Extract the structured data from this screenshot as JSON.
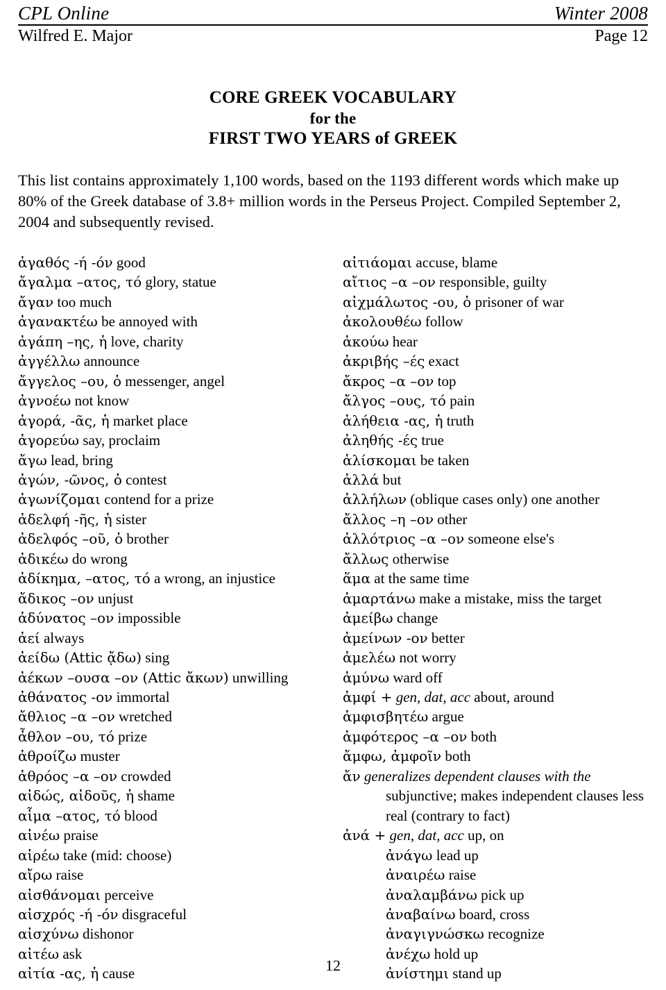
{
  "runhead": {
    "journal": "CPL Online",
    "issue": "Winter 2008",
    "author": "Wilfred E. Major",
    "page_label": "Page 12"
  },
  "title": {
    "line1": "CORE GREEK VOCABULARY",
    "line2": "for the",
    "line3": "FIRST TWO YEARS of GREEK"
  },
  "intro": "This list contains approximately 1,100 words, based on the 1193 different words which make up 80% of the Greek database of 3.8+ million words in the Perseus Project. Compiled September 2, 2004 and subsequently revised.",
  "footer": {
    "page_number": "12"
  },
  "vocabulary": {
    "left_column": [
      {
        "greek": "ἀγαθός -ή -όν",
        "english": "good"
      },
      {
        "greek": "ἄγαλμα –ατος, τό",
        "english": "glory, statue"
      },
      {
        "greek": "ἄγαν",
        "english": "too much"
      },
      {
        "greek": "ἀγανακτέω",
        "english": "be annoyed with"
      },
      {
        "greek": "ἀγάπη –ης, ἡ",
        "english": "love, charity"
      },
      {
        "greek": "ἀγγέλλω",
        "english": "announce"
      },
      {
        "greek": "ἄγγελος –ου, ὁ",
        "english": "messenger, angel"
      },
      {
        "greek": "ἀγνοέω",
        "english": "not know"
      },
      {
        "greek": "ἀγορά, -ᾶς, ἡ",
        "english": "market place"
      },
      {
        "greek": "ἀγορεύω",
        "english": "say, proclaim"
      },
      {
        "greek": "ἄγω",
        "english": "lead, bring"
      },
      {
        "greek": "ἀγών, -ῶνος, ὁ",
        "english": "contest"
      },
      {
        "greek": "ἀγωνίζομαι",
        "english": "contend for a prize"
      },
      {
        "greek": "ἀδελφή -ῆς, ἡ",
        "english": "sister"
      },
      {
        "greek": "ἀδελφός –οῦ, ὁ",
        "english": "brother"
      },
      {
        "greek": "ἀδικέω",
        "english": "do wrong"
      },
      {
        "greek": "ἀδίκημα, –ατος, τό",
        "english": "a wrong, an injustice"
      },
      {
        "greek": "ἄδικος –ον",
        "english": "unjust"
      },
      {
        "greek": "ἀδύνατος –ον",
        "english": "impossible"
      },
      {
        "greek": "ἀεί",
        "english": "always"
      },
      {
        "greek": "ἀείδω (Attic ᾄδω)",
        "english": "sing"
      },
      {
        "greek": "ἀέκων –ουσα –ον (Attic ἄκων)",
        "english": "unwilling"
      },
      {
        "greek": "ἀθάνατος -ον",
        "english": "immortal"
      },
      {
        "greek": "ἄθλιος –α –ον",
        "english": "wretched"
      },
      {
        "greek": "ἆθλον –ου, τό",
        "english": "prize"
      },
      {
        "greek": "ἀθροίζω",
        "english": "muster"
      },
      {
        "greek": "ἀθρόος –α –ον",
        "english": "crowded"
      },
      {
        "greek": "αἰδώς, αἰδοῦς, ἡ",
        "english": "shame"
      },
      {
        "greek": "αἷμα –ατος, τό",
        "english": "blood"
      },
      {
        "greek": "αἰνέω",
        "english": "praise"
      },
      {
        "greek": "αἱρέω",
        "english": "take (mid: choose)"
      },
      {
        "greek": "αἴρω",
        "english": "raise"
      },
      {
        "greek": "αἰσθάνομαι",
        "english": "perceive"
      },
      {
        "greek": "αἰσχρός -ή -όν",
        "english": "disgraceful"
      },
      {
        "greek": "αἰσχύνω",
        "english": "dishonor"
      },
      {
        "greek": "αἰτέω",
        "english": "ask"
      },
      {
        "greek": "αἰτία -ας, ἡ",
        "english": "cause"
      }
    ],
    "right_column": [
      {
        "greek": "αἰτιάομαι",
        "english": "accuse, blame"
      },
      {
        "greek": "αἴτιος –α –ον",
        "english": "responsible, guilty"
      },
      {
        "greek": "αἰχμάλωτος -ου, ὁ",
        "english": "prisoner of war"
      },
      {
        "greek": "ἀκολουθέω",
        "english": "follow"
      },
      {
        "greek": "ἀκούω",
        "english": "hear"
      },
      {
        "greek": "ἀκριβής –ές",
        "english": "exact"
      },
      {
        "greek": "ἄκρος –α –ον",
        "english": "top"
      },
      {
        "greek": "ἄλγος –ους, τό",
        "english": "pain"
      },
      {
        "greek": "ἀλήθεια -ας, ἡ",
        "english": "truth"
      },
      {
        "greek": "ἀληθής -ές",
        "english": "true"
      },
      {
        "greek": "ἁλίσκομαι",
        "english": "be taken"
      },
      {
        "greek": "ἀλλά",
        "english": "but"
      },
      {
        "greek": "ἀλλήλων",
        "english": "(oblique cases only) one another"
      },
      {
        "greek": "ἄλλος –η –ον",
        "english": "other"
      },
      {
        "greek": "ἀλλότριος –α –ον",
        "english": "someone else's"
      },
      {
        "greek": "ἄλλως",
        "english": "otherwise"
      },
      {
        "greek": "ἅμα",
        "english": "at the same time"
      },
      {
        "greek": "ἁμαρτάνω",
        "english": "make a mistake, miss the target"
      },
      {
        "greek": "ἀμείβω",
        "english": "change"
      },
      {
        "greek": "ἀμείνων -ον",
        "english": "better"
      },
      {
        "greek": "ἀμελέω",
        "english": "not worry"
      },
      {
        "greek": "ἀμύνω",
        "english": "ward off"
      },
      {
        "greek": "ἀμφί +",
        "english_italic": "gen, dat, acc",
        "english": "about, around"
      },
      {
        "greek": "ἀμφισβητέω",
        "english": "argue"
      },
      {
        "greek": "ἀμφότερος –α –ον",
        "english": "both"
      },
      {
        "greek": "ἄμφω, ἀμφοῖν",
        "english": "both"
      },
      {
        "greek": "ἄν",
        "english_italic": "generalizes dependent clauses with the",
        "continuation": [
          "subjunctive; makes independent clauses less",
          "real (contrary to fact)"
        ]
      },
      {
        "greek": "ἀνά +",
        "english_italic": "gen, dat, acc",
        "english": "up, on"
      },
      {
        "greek": "ἀνάγω",
        "english": "lead up",
        "indent": true
      },
      {
        "greek": "ἀναιρέω",
        "english": "raise",
        "indent": true
      },
      {
        "greek": "ἀναλαμβάνω",
        "english": "pick up",
        "indent": true
      },
      {
        "greek": "ἀναβαίνω",
        "english": "board, cross",
        "indent": true
      },
      {
        "greek": "ἀναγιγνώσκω",
        "english": "recognize",
        "indent": true
      },
      {
        "greek": "ἀνέχω",
        "english": "hold up",
        "indent": true
      },
      {
        "greek": "ἀνίστημι",
        "english": "stand up",
        "indent": true
      }
    ]
  }
}
